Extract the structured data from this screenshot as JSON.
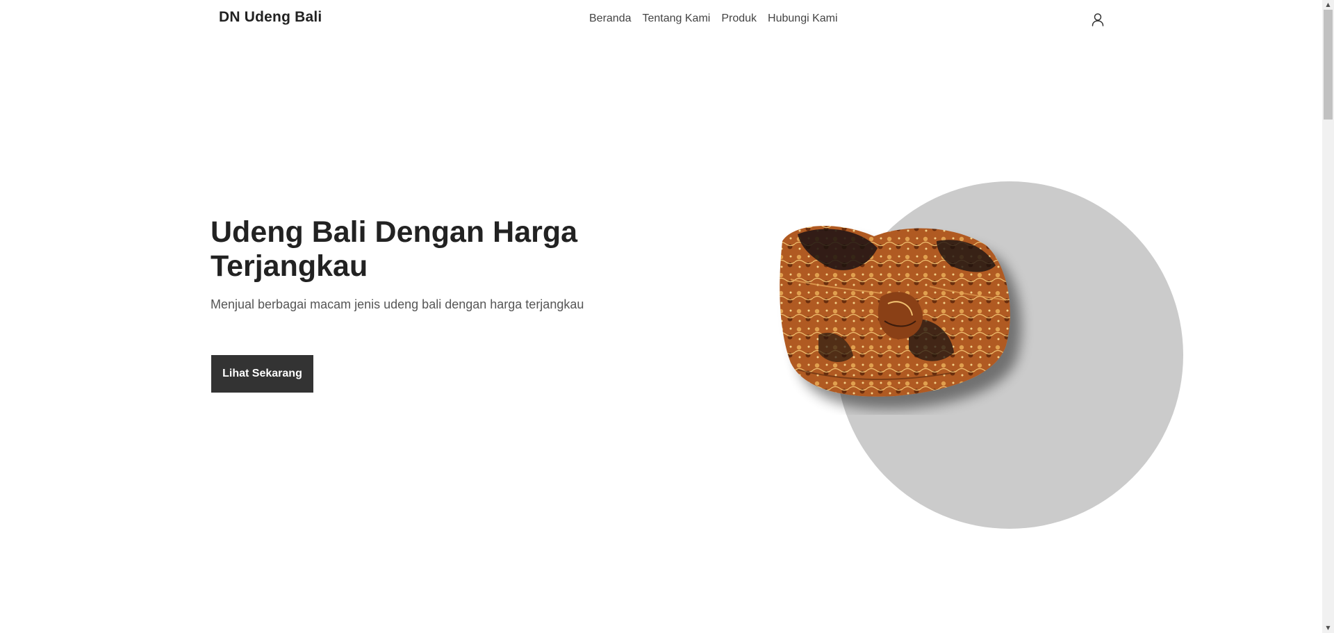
{
  "header": {
    "brand": "DN Udeng Bali",
    "nav": [
      {
        "label": "Beranda"
      },
      {
        "label": "Tentang Kami"
      },
      {
        "label": "Produk"
      },
      {
        "label": "Hubungi Kami"
      }
    ],
    "account_icon": "user-icon"
  },
  "hero": {
    "title": "Udeng Bali Dengan Harga Terjangkau",
    "subtitle": "Menjual berbagai macam jenis udeng bali dengan harga terjangkau",
    "cta_label": "Lihat Sekarang",
    "circle_color": "#cbcbcb",
    "product_image": "udeng-batik-headwear"
  },
  "colors": {
    "text": "#222222",
    "button_bg": "#333333",
    "button_text": "#ffffff",
    "nav_text": "#444444",
    "subtitle_text": "#555555"
  },
  "scrollbar": {
    "up_arrow": "▲",
    "down_arrow": "▼"
  }
}
